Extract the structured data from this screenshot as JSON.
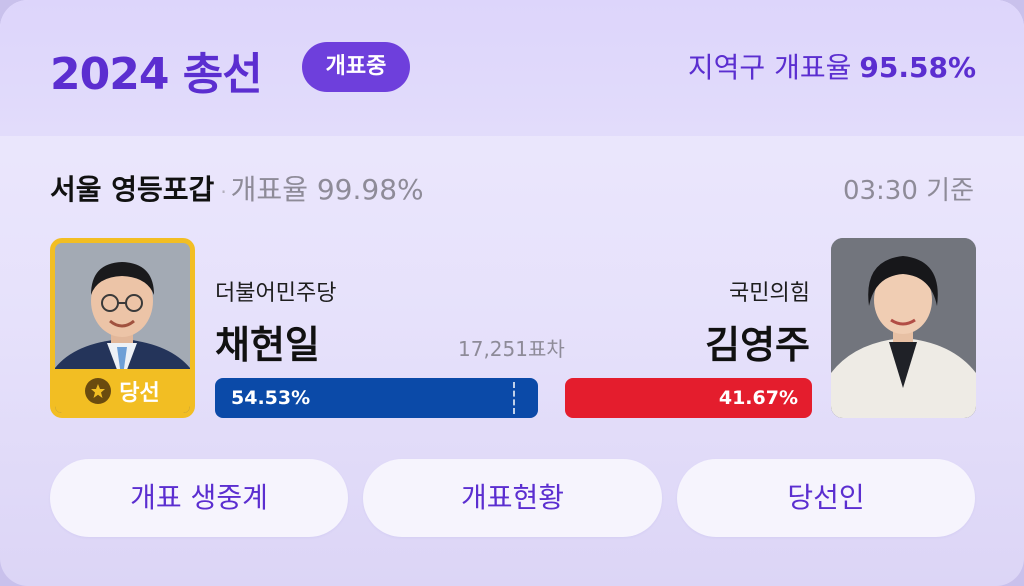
{
  "header": {
    "title": "2024 총선",
    "status_badge": "개표중",
    "national_rate_label": "지역구 개표율",
    "national_rate_value": "95.58%"
  },
  "district": {
    "name": "서울 영등포갑",
    "separator": "·",
    "count_rate": "개표율 99.98%",
    "timestamp": "03:30 기준"
  },
  "candidates": [
    {
      "party": "더불어민주당",
      "name": "채현일",
      "vote_share": "54.53%",
      "badge": "당선",
      "bar_color": "#0b4aa8"
    },
    {
      "party": "국민의힘",
      "name": "김영주",
      "vote_share": "41.67%",
      "bar_color": "#e41d2d"
    }
  ],
  "margin": "17,251표차",
  "buttons": [
    {
      "label": "개표 생중계"
    },
    {
      "label": "개표현황"
    },
    {
      "label": "당선인"
    }
  ],
  "colors": {
    "accent": "#5b2ed0",
    "winner_gold": "#f2be23"
  },
  "icons": {
    "winner_badge": "medal-icon"
  }
}
